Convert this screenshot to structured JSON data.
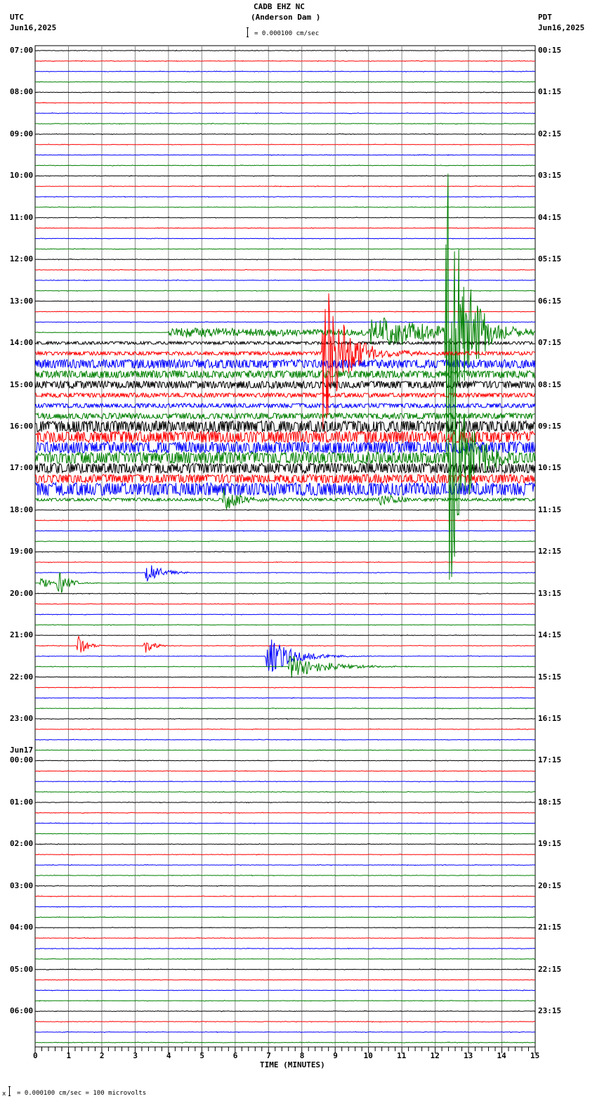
{
  "header": {
    "station": "CADB EHZ NC",
    "location": "(Anderson Dam )",
    "left_tz": "UTC",
    "left_date": "Jun16,2025",
    "right_tz": "PDT",
    "right_date": "Jun16,2025",
    "scale_text": "= 0.000100 cm/sec"
  },
  "footer": {
    "scale_text": "= 0.000100 cm/sec =     100 microvolts",
    "prefix": "x"
  },
  "chart_data": {
    "type": "line",
    "title": "CADB EHZ NC (Anderson Dam )",
    "xlabel": "TIME (MINUTES)",
    "xlim": [
      0,
      15
    ],
    "x_ticks": [
      "0",
      "1",
      "2",
      "3",
      "4",
      "5",
      "6",
      "7",
      "8",
      "9",
      "10",
      "11",
      "12",
      "13",
      "14",
      "15"
    ],
    "traces_per_hour": 4,
    "trace_colors": [
      "#000000",
      "#ff0000",
      "#0000ff",
      "#008000"
    ],
    "left_labels": [
      "07:00",
      "08:00",
      "09:00",
      "10:00",
      "11:00",
      "12:00",
      "13:00",
      "14:00",
      "15:00",
      "16:00",
      "17:00",
      "18:00",
      "19:00",
      "20:00",
      "21:00",
      "22:00",
      "23:00",
      "00:00",
      "01:00",
      "02:00",
      "03:00",
      "04:00",
      "05:00",
      "06:00"
    ],
    "left_date_change": {
      "label": "Jun17",
      "before_hour_index": 17
    },
    "right_labels": [
      "00:15",
      "01:15",
      "02:15",
      "03:15",
      "04:15",
      "05:15",
      "06:15",
      "07:15",
      "08:15",
      "09:15",
      "10:15",
      "11:15",
      "12:15",
      "13:15",
      "14:15",
      "15:15",
      "16:15",
      "17:15",
      "18:15",
      "19:15",
      "20:15",
      "21:15",
      "22:15",
      "23:15"
    ],
    "noise_levels": {
      "28": 2,
      "29": 2.5,
      "30": 6,
      "31": 5,
      "32": 5,
      "33": 3,
      "34": 3,
      "35": 4,
      "36": 8,
      "37": 8,
      "38": 8,
      "39": 8,
      "40": 7,
      "41": 6,
      "42": 9,
      "43": 2
    },
    "events": [
      {
        "trace": 27,
        "minute": 4.0,
        "amplitude": 7,
        "duration": 10
      },
      {
        "trace": 27,
        "minute": 10.0,
        "amplitude": 25,
        "duration": 2
      },
      {
        "trace": 27,
        "minute": 12.3,
        "amplitude": 300,
        "duration": 0.5
      },
      {
        "trace": 29,
        "minute": 8.6,
        "amplitude": 130,
        "duration": 0.6
      },
      {
        "trace": 39,
        "minute": 12.4,
        "amplitude": 240,
        "duration": 0.4
      },
      {
        "trace": 43,
        "minute": 5.6,
        "amplitude": 25,
        "duration": 0.4
      },
      {
        "trace": 43,
        "minute": 10.3,
        "amplitude": 15,
        "duration": 0.4
      },
      {
        "trace": 50,
        "minute": 3.3,
        "amplitude": 22,
        "duration": 0.4
      },
      {
        "trace": 51,
        "minute": 0.15,
        "amplitude": 12,
        "duration": 0.3
      },
      {
        "trace": 51,
        "minute": 0.65,
        "amplitude": 22,
        "duration": 0.3
      },
      {
        "trace": 57,
        "minute": 1.25,
        "amplitude": 18,
        "duration": 0.25
      },
      {
        "trace": 57,
        "minute": 3.25,
        "amplitude": 15,
        "duration": 0.25
      },
      {
        "trace": 58,
        "minute": 6.9,
        "amplitude": 32,
        "duration": 0.7
      },
      {
        "trace": 59,
        "minute": 7.6,
        "amplitude": 18,
        "duration": 1.0
      }
    ]
  }
}
